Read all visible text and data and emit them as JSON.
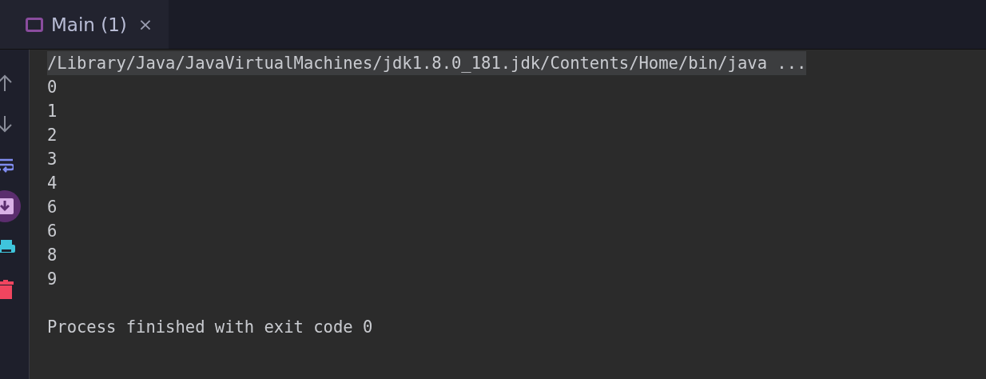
{
  "tabs": [
    {
      "label": "Main (1)",
      "selected": true,
      "close": "×"
    }
  ],
  "toolbar": [
    {
      "kind": "up"
    },
    {
      "kind": "down"
    },
    {
      "kind": "wrap"
    },
    {
      "kind": "save",
      "selected": true
    },
    {
      "kind": "print"
    },
    {
      "kind": "trash"
    }
  ],
  "console": [
    {
      "kind": "command",
      "text": "/Library/Java/JavaVirtualMachines/jdk1.8.0_181.jdk/Contents/Home/bin/java ..."
    },
    {
      "kind": "output",
      "text": "0"
    },
    {
      "kind": "output",
      "text": "1"
    },
    {
      "kind": "output",
      "text": "2"
    },
    {
      "kind": "output",
      "text": "3"
    },
    {
      "kind": "output",
      "text": "4"
    },
    {
      "kind": "output",
      "text": "6"
    },
    {
      "kind": "output",
      "text": "6"
    },
    {
      "kind": "output",
      "text": "8"
    },
    {
      "kind": "output",
      "text": "9"
    },
    {
      "kind": "blank"
    },
    {
      "kind": "output",
      "text": "Process finished with exit code 0"
    }
  ]
}
